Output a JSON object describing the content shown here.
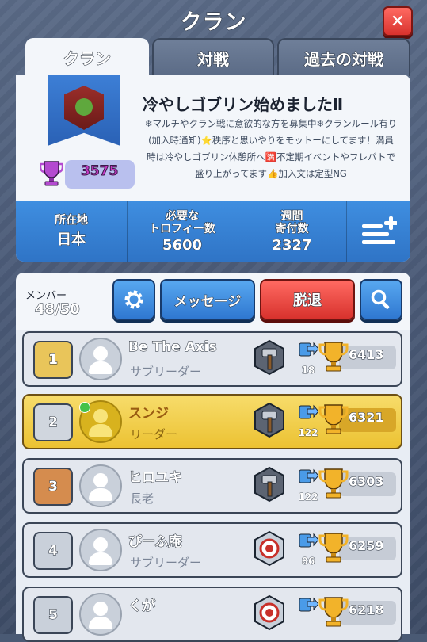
{
  "header": {
    "title": "クラン",
    "close_label": "✕"
  },
  "tabs": [
    {
      "label": "クラン",
      "active": true
    },
    {
      "label": "対戦",
      "active": false
    },
    {
      "label": "過去の対戦",
      "active": false
    }
  ],
  "clan": {
    "name": "冷やしゴブリン始めましたⅡ",
    "description": "❄マルチやクラン戦に意欲的な方を募集中❄クランルール有り(加入時通知)⭐秩序と思いやりをモットーにしてます！満員時は冷やしゴブリン休憩所へ🈵不定期イベントやフレバトで盛り上がってます👍加入文は定型NG",
    "trophies": "3575"
  },
  "stats": {
    "location_label": "所在地",
    "location_value": "日本",
    "required_label": "必要な\nトロフィー数",
    "required_value": "5600",
    "weekly_label": "週間\n寄付数",
    "weekly_value": "2327"
  },
  "actions": {
    "members_label": "メンバー",
    "members_value": "48/50",
    "message_label": "メッセージ",
    "leave_label": "脱退"
  },
  "members": [
    {
      "rank": "1",
      "name": "Be The Axis",
      "role": "サブリーダー",
      "donations": "18",
      "trophies": "6413",
      "arena": "hammer",
      "self": false,
      "online": false
    },
    {
      "rank": "2",
      "name": "スンジ",
      "role": "リーダー",
      "donations": "122",
      "trophies": "6321",
      "arena": "hammer",
      "self": true,
      "online": true
    },
    {
      "rank": "3",
      "name": "ヒロユキ",
      "role": "長老",
      "donations": "122",
      "trophies": "6303",
      "arena": "hammer",
      "self": false,
      "online": false
    },
    {
      "rank": "4",
      "name": "ぴーふ庵",
      "role": "サブリーダー",
      "donations": "86",
      "trophies": "6259",
      "arena": "target",
      "self": false,
      "online": false
    },
    {
      "rank": "5",
      "name": "くが",
      "role": "",
      "donations": "",
      "trophies": "6218",
      "arena": "target",
      "self": false,
      "online": false
    }
  ],
  "colors": {
    "accent": "#2f78d0",
    "leave": "#d8322d",
    "self_row": "#ecc232",
    "trophy_text": "#c83ac7"
  }
}
